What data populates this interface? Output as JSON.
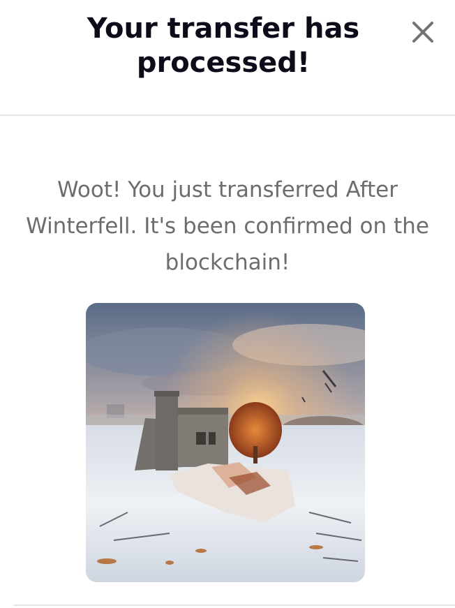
{
  "modal": {
    "title": "Your transfer has processed!",
    "message": "Woot! You just transferred After Winterfell. It's been confirmed on the blockchain!",
    "close_icon": "close-icon",
    "image_alt": "After Winterfell"
  },
  "colors": {
    "title": "#0b0b1a",
    "message": "#6a6d70",
    "divider": "#e4e4e6",
    "close_icon": "#6f7478"
  }
}
